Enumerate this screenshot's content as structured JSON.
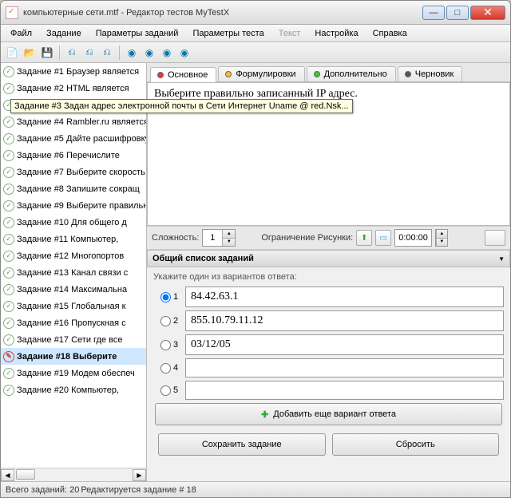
{
  "window": {
    "title": "компьютерные сети.mtf - Редактор тестов MyTestX"
  },
  "menu": {
    "file": "Файл",
    "task": "Задание",
    "taskparams": "Параметры заданий",
    "testparams": "Параметры теста",
    "text": "Текст",
    "settings": "Настройка",
    "help": "Справка"
  },
  "tasks": [
    {
      "label": "Задание #1 Браузер является"
    },
    {
      "label": "Задание #2 HTML является"
    },
    {
      "label": "Задание #3 Задан адрес"
    },
    {
      "label": "Задание #4 Rambler.ru является"
    },
    {
      "label": "Задание #5 Дайте расшифровку"
    },
    {
      "label": "Задание #6 Перечислите"
    },
    {
      "label": "Задание #7 Выберите скорость"
    },
    {
      "label": "Задание #8 Запишите сокращ"
    },
    {
      "label": "Задание #9 Выберите правильн"
    },
    {
      "label": "Задание #10 Для общего д"
    },
    {
      "label": "Задание #11 Компьютер,"
    },
    {
      "label": "Задание #12 Многопортов"
    },
    {
      "label": "Задание #13 Канал связи с"
    },
    {
      "label": "Задание #14 Максимальна"
    },
    {
      "label": "Задание #15 Глобальная к"
    },
    {
      "label": "Задание #16 Пропускная с"
    },
    {
      "label": "Задание #17 Сети где все"
    },
    {
      "label": "Задание #18 Выберите",
      "selected": true,
      "editing": true
    },
    {
      "label": "Задание #19 Модем обеспеч"
    },
    {
      "label": "Задание #20 Компьютер,"
    }
  ],
  "tabs": {
    "main": "Основное",
    "formul": "Формулировки",
    "extra": "Дополнительно",
    "draft": "Черновик"
  },
  "question": "Выберите правильно записанный  IP адрес.",
  "params": {
    "difficulty_lbl": "Сложность:",
    "difficulty": "1",
    "limit_lbl": "Ограничение Рисунки:",
    "time": "0:00:00"
  },
  "section": "Общий список заданий",
  "answers_prompt": "Укажите один из вариантов ответа:",
  "answers": [
    {
      "n": "1",
      "text": "84.42.63.1",
      "checked": true
    },
    {
      "n": "2",
      "text": "855.10.79.11.12"
    },
    {
      "n": "3",
      "text": "03/12/05"
    },
    {
      "n": "4",
      "text": ""
    },
    {
      "n": "5",
      "text": ""
    }
  ],
  "add_btn": "Добавить еще вариант ответа",
  "save_btn": "Сохранить задание",
  "reset_btn": "Сбросить",
  "status": {
    "total": "Всего заданий: 20",
    "editing": "Редактируется задание # 18"
  },
  "tooltip": "Задание #3 Задан адрес электронной почты в Сети Интернет Uname @ red.Nsk..."
}
